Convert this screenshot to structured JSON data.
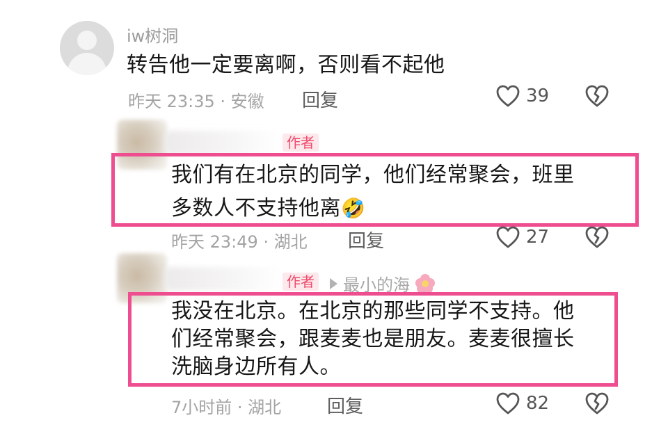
{
  "comments": [
    {
      "username": "iw树洞",
      "text": "转告他一定要离啊，否则看不起他",
      "meta": "昨天 23:35 · 安徽",
      "reply_label": "回复",
      "likes": "39"
    },
    {
      "author_tag": "作者",
      "text_line1": "我们有在北京的同学，他们经常聚会，班里",
      "text_line2": "多数人不支持他离",
      "emoji": "🤣",
      "meta": "昨天 23:49 · 湖北",
      "reply_label": "回复",
      "likes": "27"
    },
    {
      "author_tag": "作者",
      "reply_to": "最小的海",
      "text_line1": "我没在北京。在北京的那些同学不支持。他",
      "text_line2": "们经常聚会，跟麦麦也是朋友。麦麦很擅长",
      "text_line3": "洗脑身边所有人。",
      "meta": "7小时前 · 湖北",
      "reply_label": "回复",
      "likes": "82"
    }
  ],
  "icons": {
    "like": "heart-outline-icon",
    "dislike": "broken-heart-icon"
  },
  "colors": {
    "highlight_border": "#ee4d8f",
    "author_tag_text": "#f04a6b",
    "author_tag_bg": "#fde8ec",
    "meta_text": "#a3a3a3"
  }
}
